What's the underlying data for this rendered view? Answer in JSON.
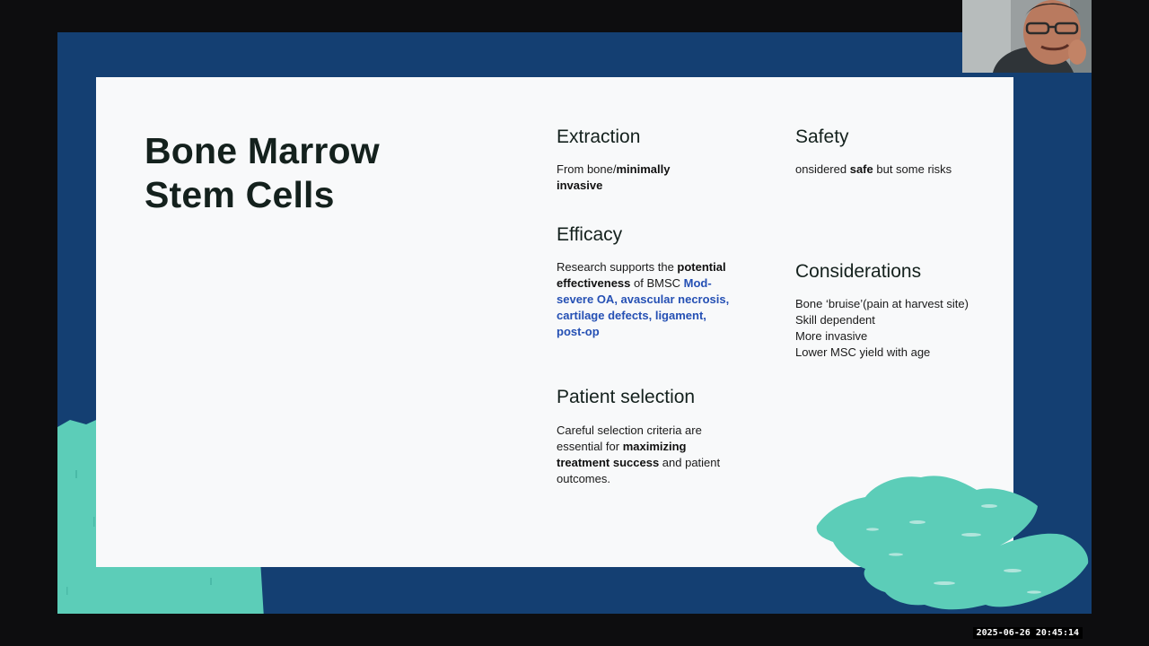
{
  "colors": {
    "frame": "#0d0d0f",
    "stage": "#143f72",
    "slide": "#f8f9fa",
    "teal": "#5ccdb8",
    "text": "#14211d",
    "highlight_blue": "#2550b4"
  },
  "slide": {
    "title_lines": [
      "Bone Marrow",
      "Stem Cells"
    ],
    "extraction": {
      "heading": "Extraction",
      "text_plain": "From bone/",
      "text_bold": "minimally invasive"
    },
    "safety": {
      "heading": "Safety",
      "text_before": "onsidered ",
      "text_bold": "safe",
      "text_after": " but some risks"
    },
    "efficacy": {
      "heading": "Efficacy",
      "text_before": "Research supports the ",
      "text_bold": "potential effectiveness",
      "text_after": " of BMSC",
      "highlight": "Mod-severe OA, avascular necrosis, cartilage defects, ligament, post-op"
    },
    "considerations": {
      "heading": "Considerations",
      "lines": [
        "Bone ‘bruise’(pain at harvest site)",
        "Skill dependent",
        "More invasive",
        "Lower MSC yield with age"
      ]
    },
    "patient_selection": {
      "heading": "Patient selection",
      "text_before": "Careful selection criteria are essential for ",
      "text_bold": "maximizing treatment success",
      "text_after": " and patient outcomes."
    }
  },
  "webcam": {
    "label": "presenter-video"
  },
  "timestamp": "2025-06-26 20:45:14"
}
